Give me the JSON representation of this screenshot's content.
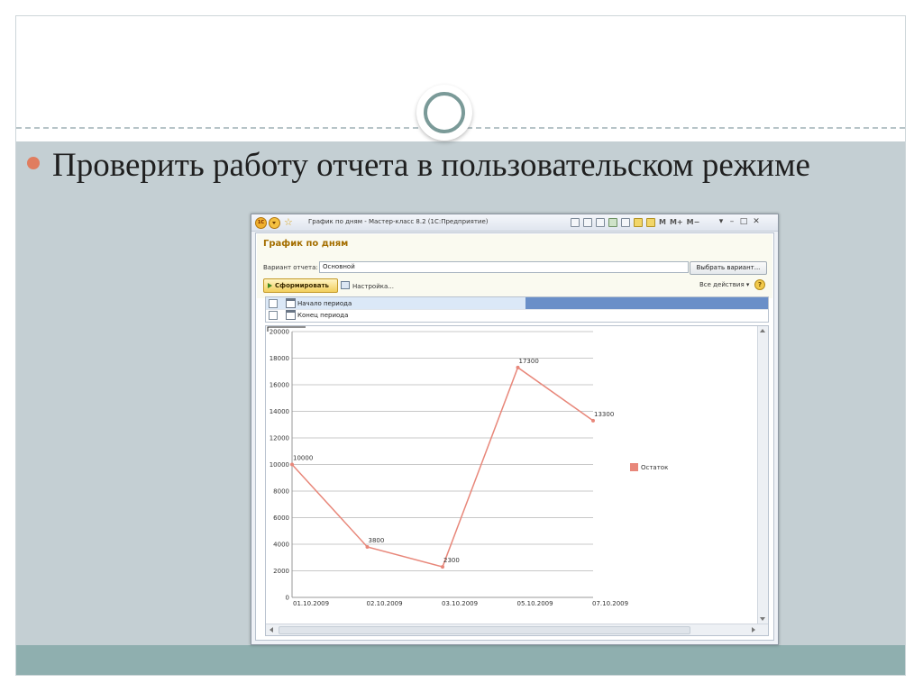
{
  "slide": {
    "bullet_text": "Проверить работу отчета в пользовательском режиме",
    "colors": {
      "body_bg": "#c4cfd3",
      "footer_bg": "#8fafaf",
      "bullet": "#e07d5f"
    }
  },
  "window": {
    "title": "График по дням - Мастер-класс 8.2  (1С:Предприятие)",
    "app_icon_label": "1С",
    "toolbar_m_labels": [
      "M",
      "M+",
      "M−"
    ],
    "form_title": "График по дням",
    "variant_label": "Вариант отчета:",
    "variant_value": "Основной",
    "select_variant_button": "Выбрать вариант...",
    "generate_button": "Сформировать",
    "settings_link": "Настройка...",
    "all_actions": "Все действия",
    "help_label": "?",
    "params": [
      {
        "label": "Начало периода",
        "checked": false
      },
      {
        "label": "Конец периода",
        "checked": false
      }
    ]
  },
  "chart_data": {
    "type": "line",
    "title": "",
    "xlabel": "",
    "ylabel": "",
    "categories": [
      "01.10.2009",
      "02.10.2009",
      "03.10.2009",
      "05.10.2009",
      "07.10.2009"
    ],
    "series": [
      {
        "name": "Остаток",
        "values": [
          10000,
          3800,
          2300,
          17300,
          13300
        ],
        "data_labels": [
          "10000",
          "3800",
          "2300",
          "17300",
          "13300"
        ],
        "color": "#e8877a"
      }
    ],
    "ylim": [
      0,
      20000
    ],
    "yticks": [
      0,
      2000,
      4000,
      6000,
      8000,
      10000,
      12000,
      14000,
      16000,
      18000,
      20000
    ],
    "grid": true,
    "legend_position": "right"
  }
}
